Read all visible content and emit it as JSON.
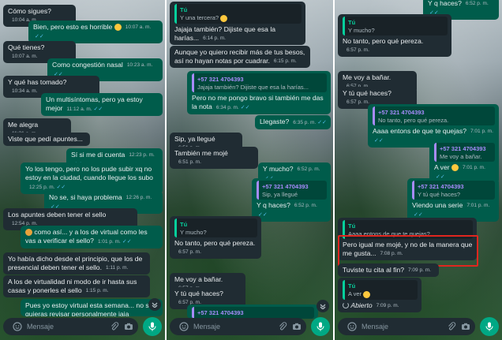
{
  "input_placeholder": "Mensaje",
  "panel1": {
    "messages": [
      {
        "text": "Cómo sigues?",
        "time": "10:04 a. m."
      },
      {
        "text": "Bien, pero esto es horrible",
        "time": "10:07 a. m."
      },
      {
        "text": "Qué tienes?",
        "time": "10:07 a. m."
      },
      {
        "text": "Como congestión nasal",
        "time": "10:23 a. m."
      },
      {
        "text": "Y qué has tomado?",
        "time": "10:34 a. m."
      },
      {
        "text": "Un multisíntomas, pero ya estoy mejor",
        "time": "11:12 a. m."
      },
      {
        "text": "Me alegra",
        "time": "11:21 a. m."
      },
      {
        "text": "Viste que pedí apuntes...",
        "time": ""
      },
      {
        "text": "Sí si me di cuenta",
        "time": "12:23 p. m."
      },
      {
        "text": "Yo los tengo, pero no los pude subir xq no estoy en la ciudad, cuando llegue los subo",
        "time": "12:25 p. m."
      },
      {
        "text": "No se, si haya problema",
        "time": "12:26 p. m."
      },
      {
        "text": "Los apuntes deben tener el sello",
        "time": "12:54 p. m."
      },
      {
        "text": "como así... y a los de virtual como les vas a verificar el sello?",
        "time": "1:01 p. m."
      },
      {
        "text": "Yo había dicho desde el principio, que los de presencial deben tener el sello.",
        "time": "1:11 p. m."
      },
      {
        "text": "A los de virtualidad ni modo de ir hasta sus casas y ponerles el sello",
        "time": "1:15 p. m."
      },
      {
        "text": "Pues yo estoy virtual esta semana... no se quieras revisar personalmente jaja",
        "time": ""
      }
    ]
  },
  "panel2": {
    "messages": [
      {
        "quote_name": "Tú",
        "quote_text": "Y una tercera?"
      },
      {
        "text": "Jajaja también? Dijiste que esa la harías...",
        "time": "6:14 p. m."
      },
      {
        "text": "Aunque yo quiero recibir más de tus besos, así no hayan notas por cuadrar.",
        "time": "6:15 p. m."
      },
      {
        "quote_name": "+57 321 4704393",
        "quote_text": "Jajaja también? Dijiste que esa la harías...",
        "text": "Pero no me pongo bravo si también me das la nota",
        "time": "6:34 p. m."
      },
      {
        "text": "Llegaste?",
        "time": "6:35 p. m."
      },
      {
        "text": "Sip, ya llegué",
        "time": "6:51 p. m."
      },
      {
        "text": "También me mojé",
        "time": "6:51 p. m."
      },
      {
        "text": "Y mucho?",
        "time": "6:52 p. m."
      },
      {
        "quote_name": "+57 321 4704393",
        "quote_text": "Sip, ya llegué",
        "text": "Y q haces?",
        "time": "6:52 p. m."
      },
      {
        "quote_name": "Tú",
        "quote_text": "Y mucho?",
        "text": "No tanto, pero qué pereza.",
        "time": "6:57 p. m."
      },
      {
        "text": "Me voy a bañar.",
        "time": "6:57 p. m."
      },
      {
        "text": "Y tú qué haces?",
        "time": "6:57 p. m."
      },
      {
        "quote_name": "+57 321 4704393",
        "quote_text": ""
      }
    ]
  },
  "panel3": {
    "messages": [
      {
        "text": "Y q haces?",
        "time": "6:52 p. m."
      },
      {
        "quote_name": "Tú",
        "quote_text": "Y mucho?",
        "text": "No tanto, pero qué pereza.",
        "time": "6:57 p. m."
      },
      {
        "text": "Me voy a bañar.",
        "time": "6:57 p. m."
      },
      {
        "text": "Y tú qué haces?",
        "time": "6:57 p. m."
      },
      {
        "quote_name": "+57 321 4704393",
        "quote_text": "No tanto, pero qué pereza.",
        "text": "Aaaa entons de que te quejas?",
        "time": "7:01 p. m."
      },
      {
        "quote_name": "+57 321 4704393",
        "quote_text": "Me voy a bañar.",
        "text": "A ver",
        "time": "7:01 p. m."
      },
      {
        "quote_name": "+57 321 4704393",
        "quote_text": "Y tú qué haces?",
        "text": "Viendo una serie",
        "time": "7:01 p. m."
      },
      {
        "quote_name": "Tú",
        "quote_text": "Aaaa entons de que te quejas?",
        "text": "Pero igual me mojé, y no de la manera que me gusta...",
        "time": "7:08 p. m."
      },
      {
        "text": "Tuviste tu cita al fin?",
        "time": "7:09 p. m."
      },
      {
        "quote_name": "Tú",
        "quote_text": "A ver",
        "text": "Abierto",
        "time": "7:09 p. m."
      }
    ]
  },
  "colors": {
    "incoming": "#202c33",
    "outgoing": "#005c4b",
    "accent": "#00a884",
    "highlight": "#e0261f"
  }
}
